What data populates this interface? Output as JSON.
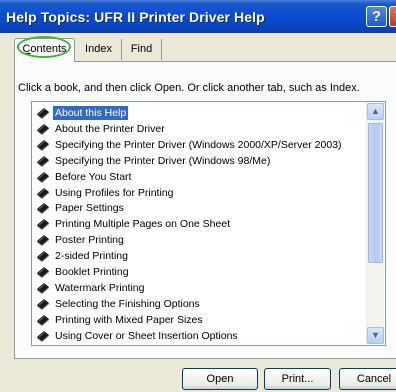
{
  "window": {
    "title": "Help Topics: UFR II Printer Driver Help",
    "help_button": "?",
    "close_button": "✕"
  },
  "tabs": [
    {
      "label_first": "C",
      "label_rest": "ontents",
      "selected": true
    },
    {
      "label": "Index",
      "selected": false
    },
    {
      "label": "Find",
      "selected": false
    }
  ],
  "instruction": "Click a book, and then click Open. Or click another tab, such as Index.",
  "tree": {
    "items": [
      {
        "label": "About this Help",
        "icon": "closed-book-icon",
        "selected": true
      },
      {
        "label": "About the Printer Driver",
        "icon": "closed-book-icon"
      },
      {
        "label": "Specifying the Printer Driver (Windows 2000/XP/Server 2003)",
        "icon": "closed-book-icon"
      },
      {
        "label": "Specifying the Printer Driver (Windows 98/Me)",
        "icon": "closed-book-icon"
      },
      {
        "label": "Before You Start",
        "icon": "closed-book-icon"
      },
      {
        "label": "Using Profiles for Printing",
        "icon": "closed-book-icon"
      },
      {
        "label": "Paper Settings",
        "icon": "closed-book-icon"
      },
      {
        "label": "Printing Multiple Pages on One Sheet",
        "icon": "closed-book-icon"
      },
      {
        "label": "Poster Printing",
        "icon": "closed-book-icon"
      },
      {
        "label": "2-sided Printing",
        "icon": "closed-book-icon"
      },
      {
        "label": "Booklet Printing",
        "icon": "closed-book-icon"
      },
      {
        "label": "Watermark Printing",
        "icon": "closed-book-icon"
      },
      {
        "label": "Selecting the Finishing Options",
        "icon": "closed-book-icon"
      },
      {
        "label": "Printing with Mixed Paper Sizes",
        "icon": "closed-book-icon"
      },
      {
        "label": "Using Cover or Sheet Insertion Options",
        "icon": "closed-book-icon"
      }
    ]
  },
  "scrollbar": {
    "up_arrow": "▲",
    "down_arrow": "▼"
  },
  "buttons": {
    "open": "Open",
    "print": "Print...",
    "cancel": "Cancel"
  },
  "colors": {
    "title_bar": "#0b4fd1",
    "selection": "#316ac5",
    "highlight_oval": "#3cb53c",
    "dialog_background": "#ece9d8"
  }
}
